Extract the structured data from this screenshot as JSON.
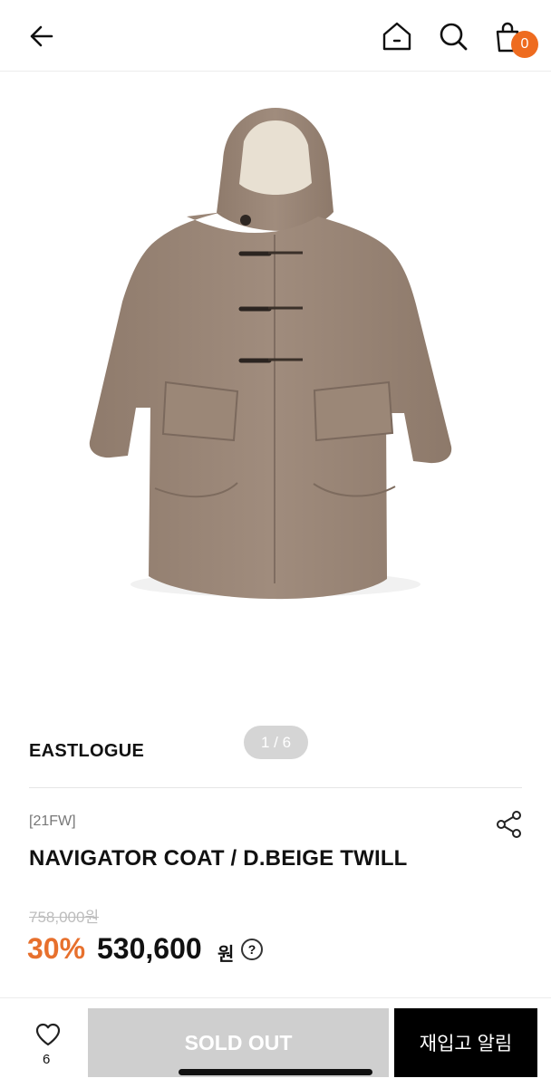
{
  "header": {
    "back_icon": "arrow-left-icon",
    "home_icon": "home-icon",
    "search_icon": "search-icon",
    "cart_icon": "shopping-bag-icon",
    "cart_count": "0"
  },
  "product": {
    "image_counter": "1 / 6",
    "brand": "EASTLOGUE",
    "season": "[21FW]",
    "title": "NAVIGATOR COAT / D.BEIGE TWILL",
    "original_price": "758,000원",
    "discount": "30%",
    "price": "530,600",
    "currency": "원",
    "help_mark": "?"
  },
  "bottom": {
    "likes": "6",
    "sold_out_label": "SOLD OUT",
    "restock_label": "재입고 알림"
  },
  "colors": {
    "accent": "#ee6b1f",
    "sold_out_button": "#cfcfcf",
    "coat": "#9b8777"
  }
}
